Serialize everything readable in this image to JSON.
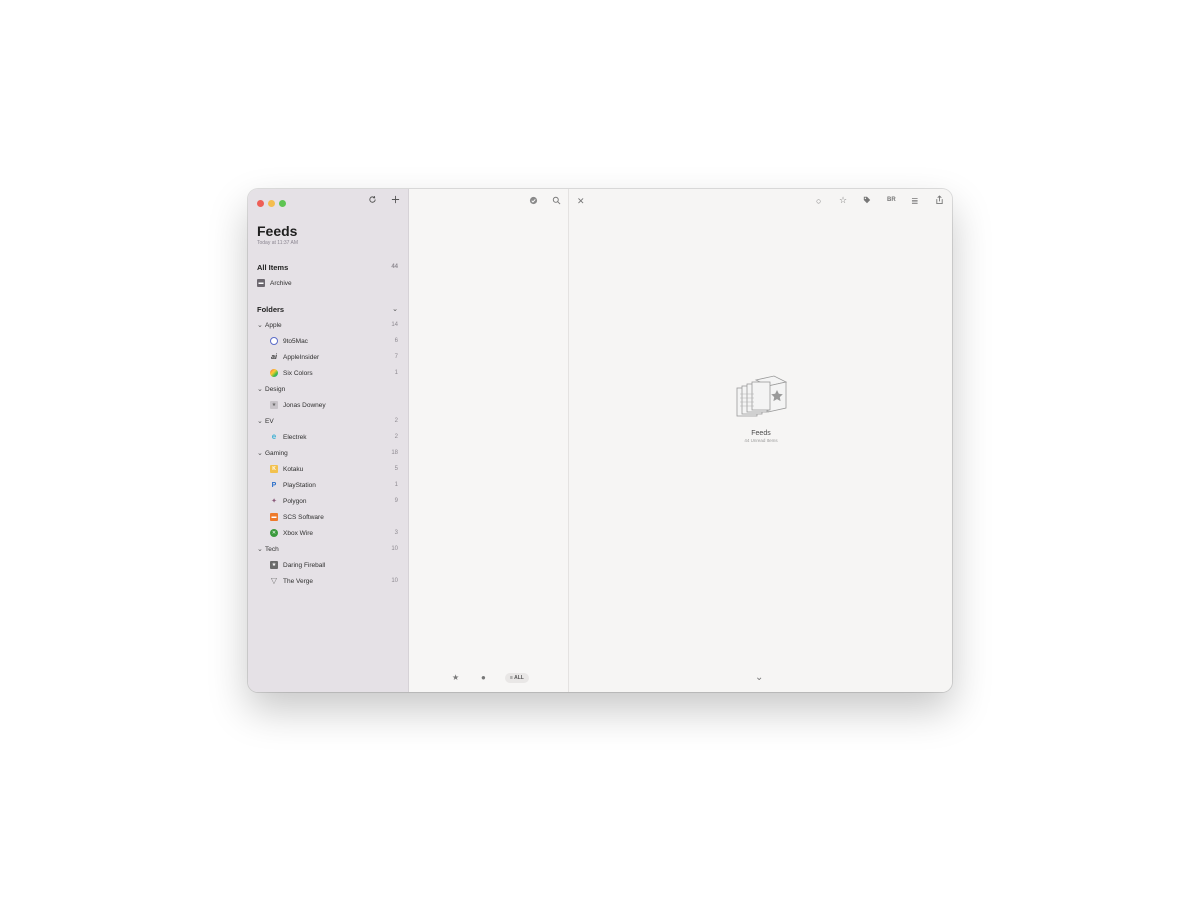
{
  "sidebar": {
    "title": "Feeds",
    "subtitle": "Today at 11:37 AM",
    "refresh_icon": "refresh-icon",
    "add_icon": "plus-icon",
    "all_items": {
      "label": "All Items",
      "count": "44"
    },
    "archive": {
      "label": "Archive"
    },
    "folders_header": "Folders",
    "folders": [
      {
        "name": "Apple",
        "count": "14",
        "feeds": [
          {
            "name": "9to5Mac",
            "count": "6"
          },
          {
            "name": "AppleInsider",
            "count": "7"
          },
          {
            "name": "Six Colors",
            "count": "1"
          }
        ]
      },
      {
        "name": "Design",
        "count": "",
        "feeds": [
          {
            "name": "Jonas Downey",
            "count": ""
          }
        ]
      },
      {
        "name": "EV",
        "count": "2",
        "feeds": [
          {
            "name": "Electrek",
            "count": "2"
          }
        ]
      },
      {
        "name": "Gaming",
        "count": "18",
        "feeds": [
          {
            "name": "Kotaku",
            "count": "5"
          },
          {
            "name": "PlayStation",
            "count": "1"
          },
          {
            "name": "Polygon",
            "count": "9"
          },
          {
            "name": "SCS Software",
            "count": ""
          },
          {
            "name": "Xbox Wire",
            "count": "3"
          }
        ]
      },
      {
        "name": "Tech",
        "count": "10",
        "feeds": [
          {
            "name": "Daring Fireball",
            "count": ""
          },
          {
            "name": "The Verge",
            "count": "10"
          }
        ]
      }
    ]
  },
  "middle": {
    "filter_all": "ALL"
  },
  "detail": {
    "empty_title": "Feeds",
    "empty_subtitle": "44 Unread Items"
  },
  "colors": {
    "sidebar_bg": "#e5e1e6",
    "pane_bg": "#f6f5f4",
    "accent_kotaku": "#f2c14e",
    "accent_scs": "#ee7a2b",
    "accent_xbox": "#3a9a3d",
    "accent_playstation": "#2a6fc9",
    "accent_electrek": "#3db0d3"
  }
}
